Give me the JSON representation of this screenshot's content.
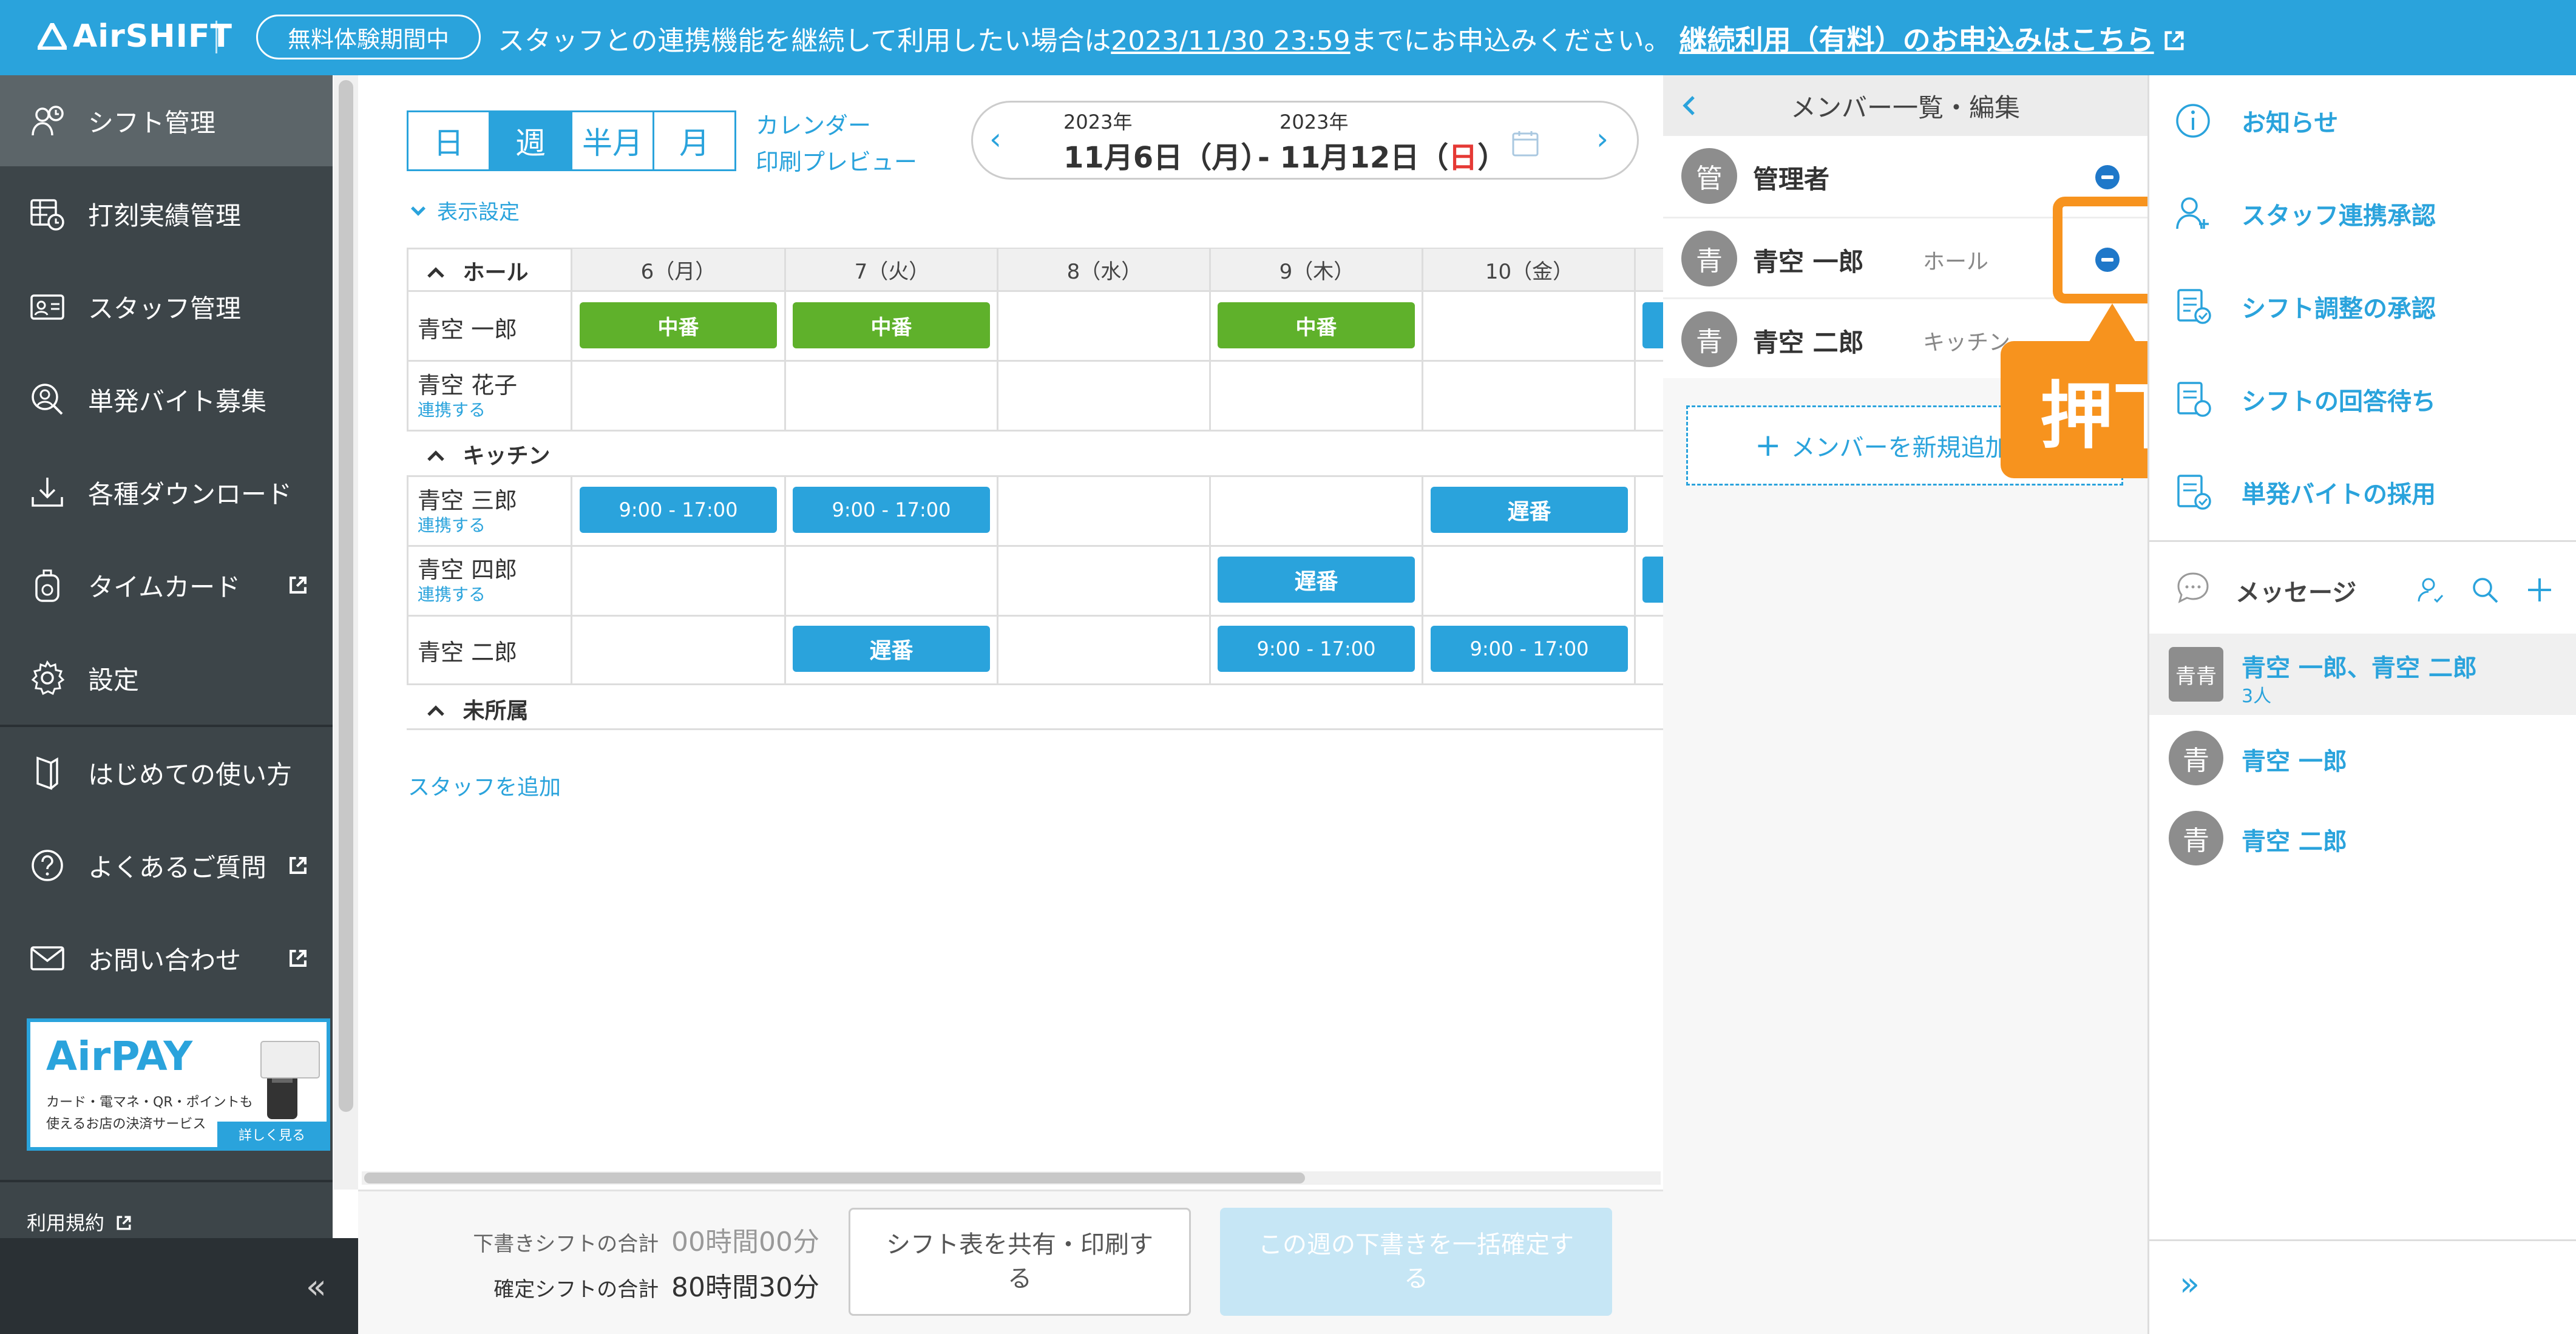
{
  "header": {
    "logo": "AirSHIFT",
    "trial_badge": "無料体験期間中",
    "notice_prefix": "スタッフとの連携機能を継続して利用したい場合は",
    "notice_deadline": "2023/11/30 23:59",
    "notice_suffix": "までにお申込みください。",
    "notice_link": "継続利用（有料）のお申込みはこちら"
  },
  "sidebar": {
    "items": [
      {
        "label": "シフト管理",
        "icon": "shift-icon"
      },
      {
        "label": "打刻実績管理",
        "icon": "timesheet-icon"
      },
      {
        "label": "スタッフ管理",
        "icon": "staff-card-icon"
      },
      {
        "label": "単発バイト募集",
        "icon": "recruit-icon"
      },
      {
        "label": "各種ダウンロード",
        "icon": "download-icon"
      },
      {
        "label": "タイムカード",
        "icon": "timecard-icon"
      },
      {
        "label": "設定",
        "icon": "gear-icon"
      },
      {
        "label": "はじめての使い方",
        "icon": "guide-icon"
      },
      {
        "label": "よくあるご質問",
        "icon": "question-icon"
      },
      {
        "label": "お問い合わせ",
        "icon": "mail-icon"
      }
    ],
    "airpay": {
      "title": "AirPAY",
      "line1": "カード・電マネ・QR・ポイントも",
      "line2": "使えるお店の決済サービス",
      "more": "詳しく見る"
    },
    "terms": "利用規約",
    "collapse": "«"
  },
  "toolbar": {
    "views": [
      "日",
      "週",
      "半月",
      "月"
    ],
    "calendar_link": "カレンダー",
    "print_link": "印刷プレビュー",
    "start_year": "2023年",
    "start_date": "11月6日（月）",
    "end_year": "2023年",
    "end_date_prefix": "- 11月12日（",
    "end_date_day": "日",
    "end_date_suffix": "）",
    "display_settings": "表示設定"
  },
  "grid": {
    "days": [
      "6（月）",
      "7（火）",
      "8（水）",
      "9（木）",
      "10（金）"
    ],
    "sections": [
      "ホール",
      "キッチン",
      "未所属"
    ],
    "rows": [
      {
        "name": "青空 一郎",
        "link": "",
        "shifts": [
          "中番",
          "中番",
          "",
          "中番",
          ""
        ]
      },
      {
        "name": "青空 花子",
        "link": "連携する",
        "shifts": [
          "",
          "",
          "",
          "",
          ""
        ]
      },
      {
        "name": "青空 三郎",
        "link": "連携する",
        "shifts": [
          "9:00 - 17:00",
          "9:00 - 17:00",
          "",
          "",
          "遅番"
        ]
      },
      {
        "name": "青空 四郎",
        "link": "連携する",
        "shifts": [
          "",
          "",
          "",
          "遅番",
          ""
        ]
      },
      {
        "name": "青空 二郎",
        "link": "",
        "shifts": [
          "",
          "遅番",
          "",
          "9:00 - 17:00",
          "9:00 - 17:00"
        ]
      }
    ],
    "add_staff": "スタッフを追加"
  },
  "footer": {
    "draft_label": "下書きシフトの合計",
    "draft_value": "00時間00分",
    "confirmed_label": "確定シフトの合計",
    "confirmed_value": "80時間30分",
    "share_btn_l1": "シフト表を共有・印刷す",
    "share_btn_l2": "る",
    "confirm_btn_l1": "この週の下書きを一括確定す",
    "confirm_btn_l2": "る"
  },
  "member_panel": {
    "title": "メンバー一覧・編集",
    "members": [
      {
        "initial": "管",
        "name": "管理者",
        "dept": ""
      },
      {
        "initial": "青",
        "name": "青空 一郎",
        "dept": "ホール"
      },
      {
        "initial": "青",
        "name": "青空 二郎",
        "dept": "キッチン"
      }
    ],
    "add_member": "メンバーを新規追加",
    "callout": "押下"
  },
  "right_panel": {
    "items": [
      {
        "label": "お知らせ",
        "icon": "info-icon"
      },
      {
        "label": "スタッフ連携承認",
        "icon": "user-add-icon"
      },
      {
        "label": "シフト調整の承認",
        "icon": "document-check-icon"
      },
      {
        "label": "シフトの回答待ち",
        "icon": "document-wait-icon"
      },
      {
        "label": "単発バイトの採用",
        "icon": "document-hire-icon"
      }
    ],
    "messages_title": "メッセージ",
    "threads": [
      {
        "avatar": "青青",
        "name": "青空 一郎、青空 二郎",
        "sub": "3人"
      },
      {
        "avatar": "青",
        "name": "青空 一郎",
        "sub": ""
      },
      {
        "avatar": "青",
        "name": "青空 二郎",
        "sub": ""
      }
    ],
    "expand": "»"
  },
  "colors": {
    "accent": "#2aa3dc",
    "green": "#5fb12b",
    "sidebar": "#3d4549",
    "callout": "#f7931e",
    "red": "#e53935"
  }
}
